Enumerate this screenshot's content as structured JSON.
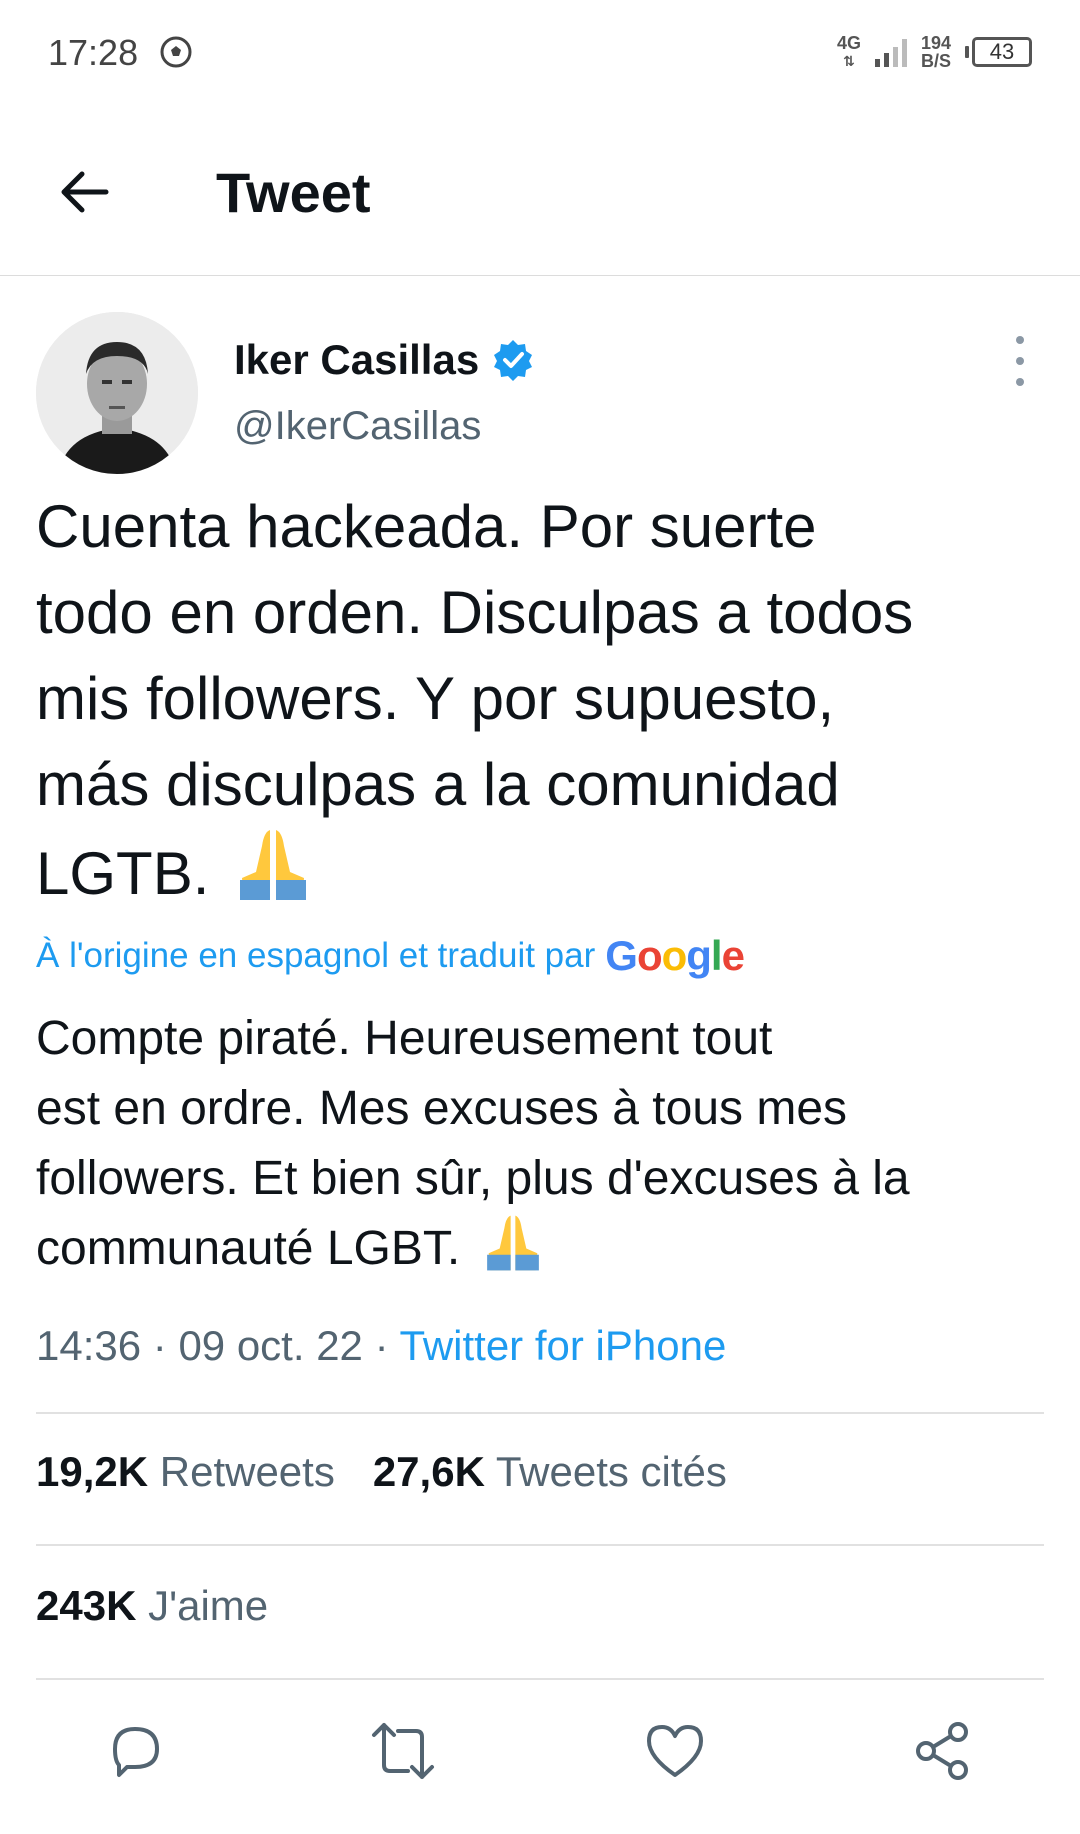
{
  "status_bar": {
    "time": "17:28",
    "network": "4G",
    "speed_value": "194",
    "speed_unit": "B/S",
    "battery": "43"
  },
  "header": {
    "title": "Tweet"
  },
  "author": {
    "name": "Iker Casillas",
    "handle": "@IkerCasillas"
  },
  "tweet": {
    "lines": [
      "Cuenta hackeada. Por suerte",
      "todo en orden. Disculpas a todos",
      "mis followers. Y por supuesto,",
      "más disculpas a la comunidad",
      "LGTB."
    ],
    "translation_note": "À l'origine en espagnol et traduit par",
    "translation_provider": "Google",
    "translated_lines": [
      "Compte piraté. Heureusement tout",
      "est en ordre. Mes excuses à tous mes",
      "followers. Et bien sûr, plus d'excuses à la",
      "communauté LGBT."
    ],
    "time": "14:36",
    "date": "09 oct. 22",
    "source": "Twitter for iPhone"
  },
  "stats": {
    "retweets_count": "19,2K",
    "retweets_label": "Retweets",
    "quotes_count": "27,6K",
    "quotes_label": "Tweets cités",
    "likes_count": "243K",
    "likes_label": "J'aime"
  },
  "colors": {
    "accent": "#1d9bf0",
    "secondary_text": "#536471",
    "text": "#0f1419"
  }
}
